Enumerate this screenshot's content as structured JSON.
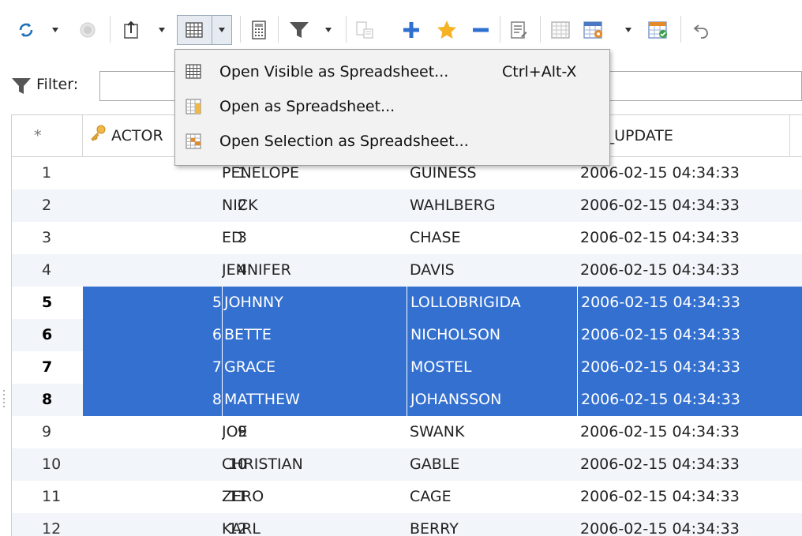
{
  "filter": {
    "label": "Filter:",
    "value": ""
  },
  "menu": {
    "items": [
      {
        "label": "Open Visible as Spreadsheet...",
        "shortcut": "Ctrl+Alt-X",
        "icon": "grid-icon"
      },
      {
        "label": "Open as Spreadsheet...",
        "shortcut": "",
        "icon": "spreadsheet-icon"
      },
      {
        "label": "Open Selection as Spreadsheet...",
        "shortcut": "",
        "icon": "selection-spreadsheet-icon"
      }
    ]
  },
  "grid": {
    "corner": "*",
    "headers": {
      "actor_id": "ACTOR",
      "last_update": "T_UPDATE"
    },
    "rows": [
      {
        "n": "1",
        "id": "1",
        "first": "PENELOPE",
        "last": "GUINESS",
        "updated": "2006-02-15 04:34:33"
      },
      {
        "n": "2",
        "id": "2",
        "first": "NICK",
        "last": "WAHLBERG",
        "updated": "2006-02-15 04:34:33"
      },
      {
        "n": "3",
        "id": "3",
        "first": "ED",
        "last": "CHASE",
        "updated": "2006-02-15 04:34:33"
      },
      {
        "n": "4",
        "id": "4",
        "first": "JENNIFER",
        "last": "DAVIS",
        "updated": "2006-02-15 04:34:33"
      },
      {
        "n": "5",
        "id": "5",
        "first": "JOHNNY",
        "last": "LOLLOBRIGIDA",
        "updated": "2006-02-15 04:34:33"
      },
      {
        "n": "6",
        "id": "6",
        "first": "BETTE",
        "last": "NICHOLSON",
        "updated": "2006-02-15 04:34:33"
      },
      {
        "n": "7",
        "id": "7",
        "first": "GRACE",
        "last": "MOSTEL",
        "updated": "2006-02-15 04:34:33"
      },
      {
        "n": "8",
        "id": "8",
        "first": "MATTHEW",
        "last": "JOHANSSON",
        "updated": "2006-02-15 04:34:33"
      },
      {
        "n": "9",
        "id": "9",
        "first": "JOE",
        "last": "SWANK",
        "updated": "2006-02-15 04:34:33"
      },
      {
        "n": "10",
        "id": "10",
        "first": "CHRISTIAN",
        "last": "GABLE",
        "updated": "2006-02-15 04:34:33"
      },
      {
        "n": "11",
        "id": "11",
        "first": "ZERO",
        "last": "CAGE",
        "updated": "2006-02-15 04:34:33"
      },
      {
        "n": "12",
        "id": "12",
        "first": "KARL",
        "last": "BERRY",
        "updated": "2006-02-15 04:34:33"
      }
    ]
  },
  "colors": {
    "selection": "#3370d0",
    "accent_blue": "#2f6fcf",
    "star": "#f5b324",
    "stripe": "#f2f5f9"
  }
}
